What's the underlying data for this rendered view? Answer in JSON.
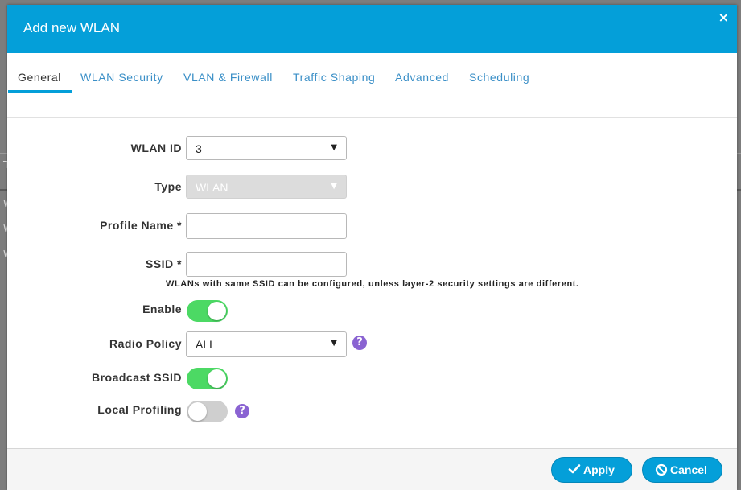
{
  "background": {
    "rows": [
      "T",
      "W",
      "W",
      "W"
    ]
  },
  "modal": {
    "title": "Add new WLAN",
    "close_glyph": "×"
  },
  "tabs": [
    {
      "label": "General",
      "active": true
    },
    {
      "label": "WLAN Security",
      "active": false
    },
    {
      "label": "VLAN & Firewall",
      "active": false
    },
    {
      "label": "Traffic Shaping",
      "active": false
    },
    {
      "label": "Advanced",
      "active": false
    },
    {
      "label": "Scheduling",
      "active": false
    }
  ],
  "form": {
    "wlan_id": {
      "label": "WLAN ID",
      "value": "3"
    },
    "type": {
      "label": "Type",
      "value": "WLAN",
      "disabled": true
    },
    "profile_name": {
      "label": "Profile Name *",
      "value": ""
    },
    "ssid": {
      "label": "SSID *",
      "value": ""
    },
    "ssid_hint": "WLANs with same SSID can be configured, unless layer-2 security settings are different.",
    "enable": {
      "label": "Enable",
      "on": true
    },
    "radio_policy": {
      "label": "Radio Policy",
      "value": "ALL"
    },
    "broadcast_ssid": {
      "label": "Broadcast SSID",
      "on": true
    },
    "local_profiling": {
      "label": "Local Profiling",
      "on": false
    }
  },
  "footer": {
    "apply_label": "Apply",
    "cancel_label": "Cancel"
  },
  "colors": {
    "header": "#049fd9",
    "toggle_on": "#4cd964",
    "toggle_off": "#cfcfcf",
    "help_icon": "#8a63d2",
    "tab_link": "#3a8fc7"
  }
}
